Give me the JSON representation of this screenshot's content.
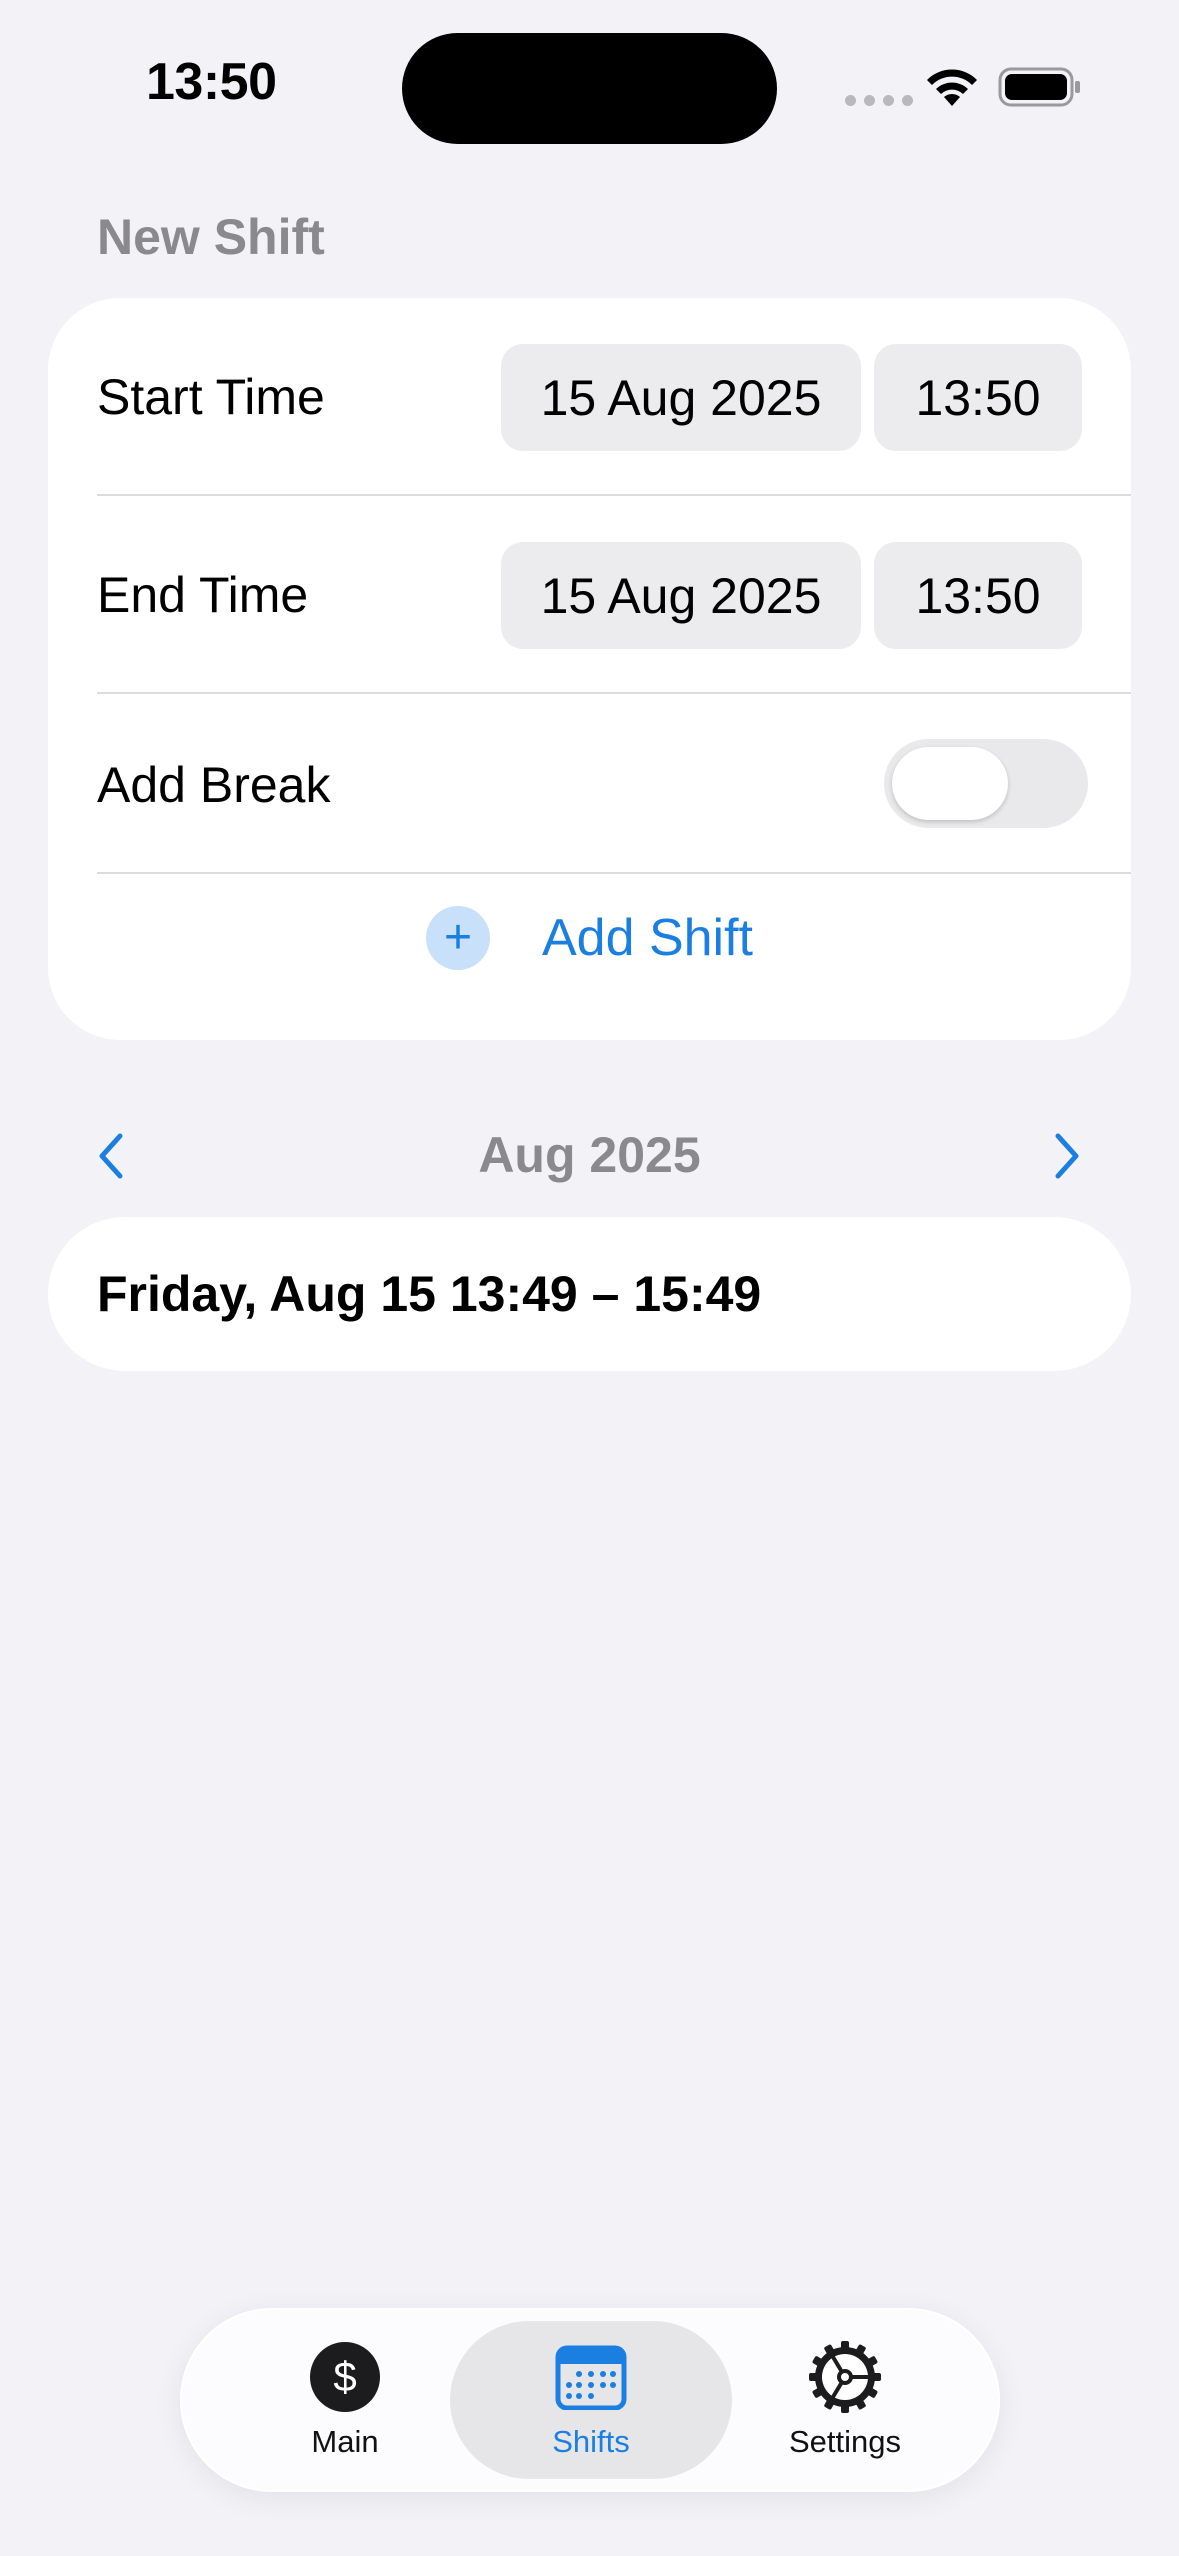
{
  "status_bar": {
    "time": "13:50"
  },
  "new_shift": {
    "section_title": "New Shift",
    "start": {
      "label": "Start Time",
      "date": "15 Aug 2025",
      "time": "13:50"
    },
    "end": {
      "label": "End Time",
      "date": "15 Aug 2025",
      "time": "13:50"
    },
    "break": {
      "label": "Add Break",
      "enabled": false
    },
    "add_button": {
      "icon": "plus-icon",
      "label": "Add Shift"
    }
  },
  "month_nav": {
    "title": "Aug 2025",
    "prev_icon": "chevron-left-icon",
    "next_icon": "chevron-right-icon"
  },
  "shifts": [
    {
      "text": "Friday, Aug 15 13:49 – 15:49"
    }
  ],
  "tab_bar": {
    "tabs": [
      {
        "label": "Main",
        "icon": "dollar-icon",
        "active": false
      },
      {
        "label": "Shifts",
        "icon": "calendar-icon",
        "active": true
      },
      {
        "label": "Settings",
        "icon": "gear-icon",
        "active": false
      }
    ]
  },
  "colors": {
    "accent": "#1a7fe0",
    "background": "#f2f2f7",
    "secondary_text": "#8a8a8e"
  }
}
